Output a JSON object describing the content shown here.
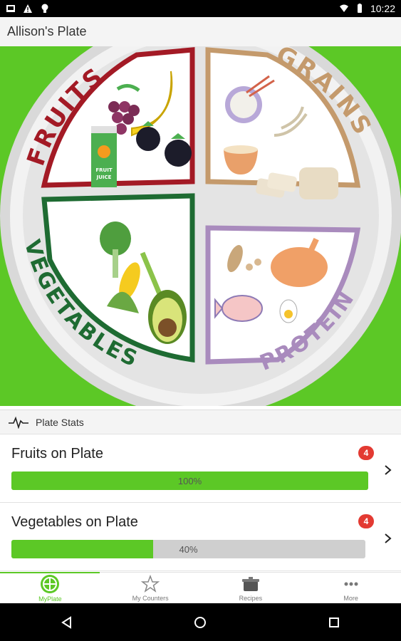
{
  "status_bar": {
    "time": "10:22",
    "icons": [
      "image-icon",
      "warning-icon",
      "lightbulb-icon",
      "wifi-icon",
      "battery-icon"
    ]
  },
  "app_bar": {
    "title": "Allison's Plate"
  },
  "plate": {
    "sections": [
      {
        "label": "FRUITS",
        "color": "#a31a25",
        "items": [
          "grapes",
          "banana",
          "blackberries",
          "fruit-juice"
        ]
      },
      {
        "label": "GRAINS",
        "color": "#c49a6c",
        "items": [
          "rice-bowl",
          "wheat",
          "cereal-bowl",
          "bread-slices"
        ]
      },
      {
        "label": "VEGETABLES",
        "color": "#1e6b32",
        "items": [
          "lettuce",
          "corn",
          "asparagus",
          "avocado"
        ]
      },
      {
        "label": "PROTEIN",
        "color": "#a98bbd",
        "items": [
          "peanuts",
          "chicken",
          "fish",
          "egg"
        ]
      }
    ],
    "juice_label": "FRUIT JUICE",
    "background_color": "#5cc826"
  },
  "stats": {
    "header": "Plate Stats",
    "rows": [
      {
        "title": "Fruits on Plate",
        "badge": "4",
        "percent_label": "100%",
        "percent": 100
      },
      {
        "title": "Vegetables on Plate",
        "badge": "4",
        "percent_label": "40%",
        "percent": 40
      }
    ]
  },
  "bottom_nav": {
    "items": [
      {
        "label": "MyPlate",
        "icon": "myplate-icon",
        "active": true
      },
      {
        "label": "My Counters",
        "icon": "star-icon",
        "active": false
      },
      {
        "label": "Recipes",
        "icon": "pot-icon",
        "active": false
      },
      {
        "label": "More",
        "icon": "more-dots-icon",
        "active": false
      }
    ]
  },
  "system_nav": {
    "icons": [
      "back-icon",
      "home-icon",
      "recents-icon"
    ]
  }
}
